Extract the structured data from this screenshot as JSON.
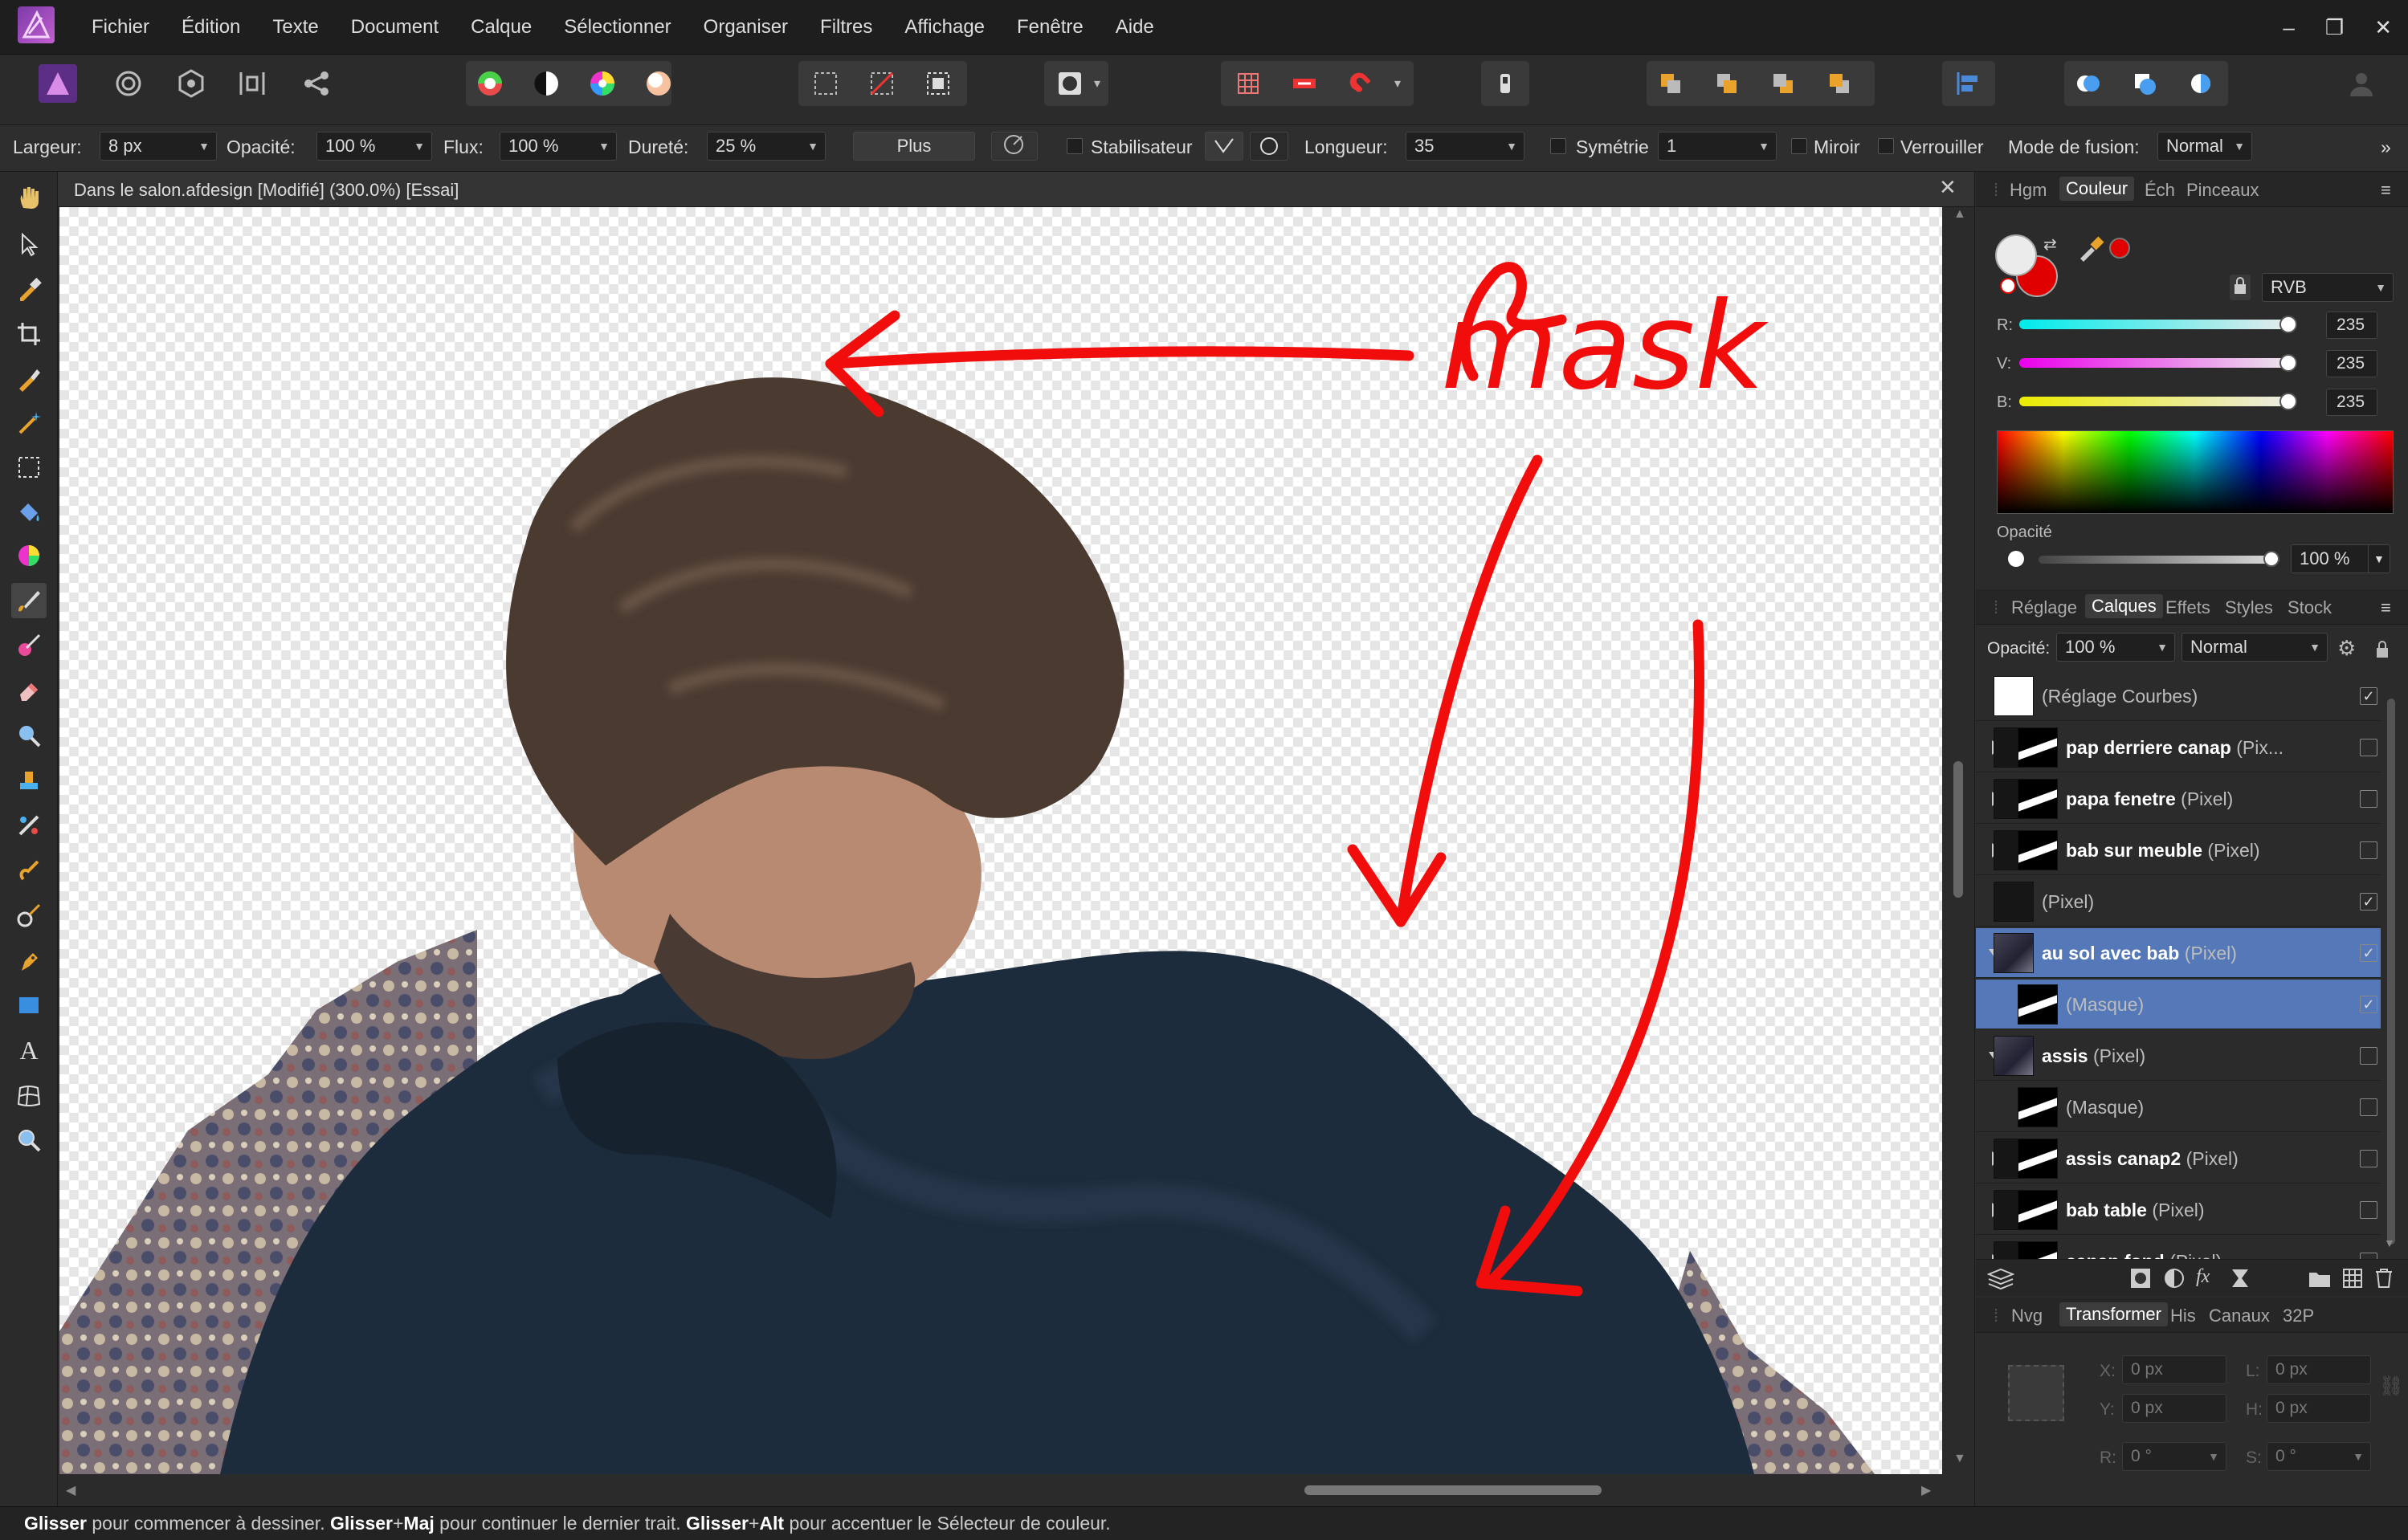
{
  "menubar": {
    "items": [
      "Fichier",
      "Édition",
      "Texte",
      "Document",
      "Calque",
      "Sélectionner",
      "Organiser",
      "Filtres",
      "Affichage",
      "Fenêtre",
      "Aide"
    ],
    "win": [
      "–",
      "❐",
      "✕"
    ]
  },
  "context": {
    "largeur_label": "Largeur:",
    "largeur": "8 px",
    "opacite_label": "Opacité:",
    "opacite": "100 %",
    "flux_label": "Flux:",
    "flux": "100 %",
    "durete_label": "Dureté:",
    "durete": "25 %",
    "plus": "Plus",
    "stabilisateur": "Stabilisateur",
    "longueur_label": "Longueur:",
    "longueur": "35",
    "symetrie": "Symétrie",
    "symetrie_val": "1",
    "miroir": "Miroir",
    "verrouiller": "Verrouiller",
    "mode_label": "Mode de fusion:",
    "mode": "Normal",
    "more": "»"
  },
  "document": {
    "title": "Dans le salon.afdesign [Modifié] (300.0%) [Essai]",
    "close": "✕",
    "annotation": "mask"
  },
  "color_panel": {
    "tabs": [
      "Hgm",
      "Couleur",
      "Éch",
      "Pinceaux"
    ],
    "active": "Couleur",
    "model": "RVB",
    "r_label": "R:",
    "r": "235",
    "v_label": "V:",
    "v": "235",
    "b_label": "B:",
    "b": "235",
    "opacity_label": "Opacité",
    "opacity": "100 %",
    "primary": "#ebebeb",
    "secondary": "#e00000"
  },
  "layers_panel": {
    "tabs": [
      "Réglage",
      "Calques",
      "Effets",
      "Styles",
      "Stock"
    ],
    "active": "Calques",
    "opacity_label": "Opacité:",
    "opacity": "100 %",
    "blend": "Normal",
    "layers": [
      {
        "name": "(Réglage Courbes)",
        "type": "",
        "checked": true,
        "expander": "none",
        "indent": 0,
        "dim": true
      },
      {
        "name": "pap derriere canap",
        "type": "(Pix...",
        "checked": false,
        "expander": "right",
        "indent": 0
      },
      {
        "name": "papa fenetre",
        "type": "(Pixel)",
        "checked": false,
        "expander": "right",
        "indent": 0
      },
      {
        "name": "bab sur meuble",
        "type": "(Pixel)",
        "checked": false,
        "expander": "right",
        "indent": 0
      },
      {
        "name": "(Pixel)",
        "type": "",
        "checked": true,
        "expander": "none",
        "indent": 0,
        "dim": true
      },
      {
        "name": "au sol avec bab",
        "type": "(Pixel)",
        "checked": true,
        "expander": "down",
        "indent": 0,
        "selected": true
      },
      {
        "name": "(Masque)",
        "type": "",
        "checked": true,
        "expander": "none",
        "indent": 1,
        "selected": true,
        "dim": true
      },
      {
        "name": "assis",
        "type": "(Pixel)",
        "checked": false,
        "expander": "down",
        "indent": 0
      },
      {
        "name": "(Masque)",
        "type": "",
        "checked": false,
        "expander": "none",
        "indent": 1,
        "dim": true
      },
      {
        "name": "assis canap2",
        "type": "(Pixel)",
        "checked": false,
        "expander": "right",
        "indent": 0
      },
      {
        "name": "bab table",
        "type": "(Pixel)",
        "checked": false,
        "expander": "right",
        "indent": 0
      },
      {
        "name": "canap fond",
        "type": "(Pixel)",
        "checked": false,
        "expander": "right",
        "indent": 0
      }
    ]
  },
  "transform_panel": {
    "tabs": [
      "Nvg",
      "Transformer",
      "His",
      "Canaux",
      "32P"
    ],
    "active": "Transformer",
    "x_label": "X:",
    "x": "0 px",
    "y_label": "Y:",
    "y": "0 px",
    "l_label": "L:",
    "l": "0 px",
    "h_label": "H:",
    "h": "0 px",
    "r_label": "R:",
    "r": "0 °",
    "s_label": "S:",
    "s": "0 °"
  },
  "status": {
    "s1": "Glisser",
    "t1": " pour commencer à dessiner. ",
    "s2": "Glisser",
    "p2": "+",
    "s2b": "Maj",
    "t2": " pour continuer le dernier trait. ",
    "s3": "Glisser",
    "p3": "+",
    "s3b": "Alt",
    "t3": " pour accentuer le Sélecteur de couleur."
  }
}
